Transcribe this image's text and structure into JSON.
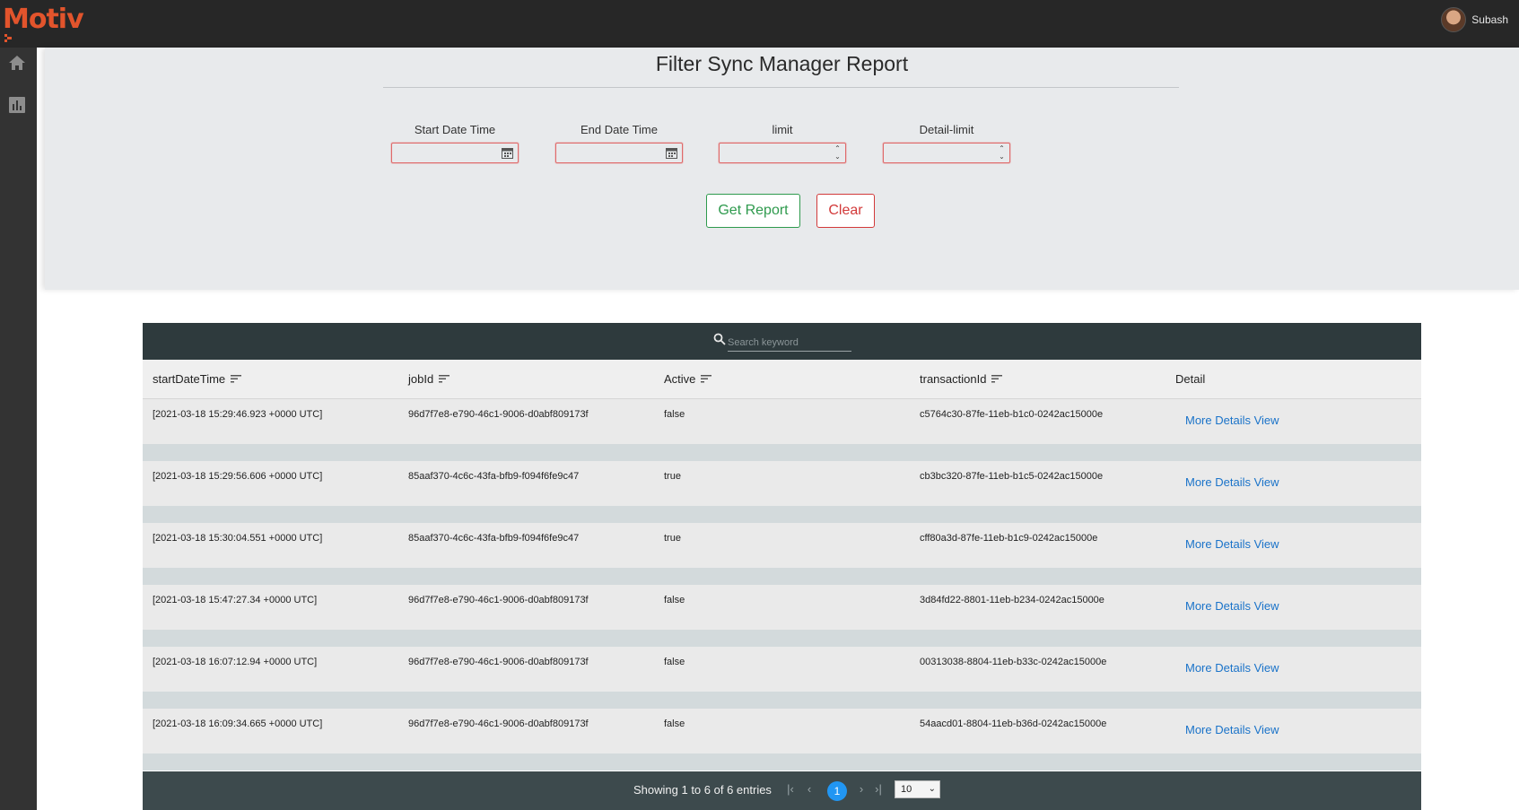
{
  "brand": {
    "name": "Motiv",
    "color": "#e2542c"
  },
  "user": {
    "name": "Subash"
  },
  "sidebar": {
    "items": [
      {
        "icon": "home-icon"
      },
      {
        "icon": "bar-chart-icon"
      }
    ]
  },
  "page": {
    "title": "Filter Sync Manager Report"
  },
  "filters": {
    "start_label": "Start Date Time",
    "end_label": "End Date Time",
    "limit_label": "limit",
    "detail_limit_label": "Detail-limit"
  },
  "actions": {
    "get_report": "Get Report",
    "clear": "Clear"
  },
  "table": {
    "search_placeholder": "Search keyword",
    "columns": [
      "startDateTime",
      "jobId",
      "Active",
      "transactionId",
      "Detail"
    ],
    "rows": [
      {
        "start": "[2021-03-18 15:29:46.923 +0000 UTC]",
        "job": "96d7f7e8-e790-46c1-9006-d0abf809173f",
        "active": "false",
        "txn": "c5764c30-87fe-11eb-b1c0-0242ac15000e",
        "detail": "More Details View"
      },
      {
        "start": "[2021-03-18 15:29:56.606 +0000 UTC]",
        "job": "85aaf370-4c6c-43fa-bfb9-f094f6fe9c47",
        "active": "true",
        "txn": "cb3bc320-87fe-11eb-b1c5-0242ac15000e",
        "detail": "More Details View"
      },
      {
        "start": "[2021-03-18 15:30:04.551 +0000 UTC]",
        "job": "85aaf370-4c6c-43fa-bfb9-f094f6fe9c47",
        "active": "true",
        "txn": "cff80a3d-87fe-11eb-b1c9-0242ac15000e",
        "detail": "More Details View"
      },
      {
        "start": "[2021-03-18 15:47:27.34 +0000 UTC]",
        "job": "96d7f7e8-e790-46c1-9006-d0abf809173f",
        "active": "false",
        "txn": "3d84fd22-8801-11eb-b234-0242ac15000e",
        "detail": "More Details View"
      },
      {
        "start": "[2021-03-18 16:07:12.94 +0000 UTC]",
        "job": "96d7f7e8-e790-46c1-9006-d0abf809173f",
        "active": "false",
        "txn": "00313038-8804-11eb-b33c-0242ac15000e",
        "detail": "More Details View"
      },
      {
        "start": "[2021-03-18 16:09:34.665 +0000 UTC]",
        "job": "96d7f7e8-e790-46c1-9006-d0abf809173f",
        "active": "false",
        "txn": "54aacd01-8804-11eb-b36d-0242ac15000e",
        "detail": "More Details View"
      }
    ]
  },
  "pagination": {
    "info": "Showing 1 to 6 of 6 entries",
    "current_page": "1",
    "page_size": "10",
    "accent": "#2196f3"
  }
}
